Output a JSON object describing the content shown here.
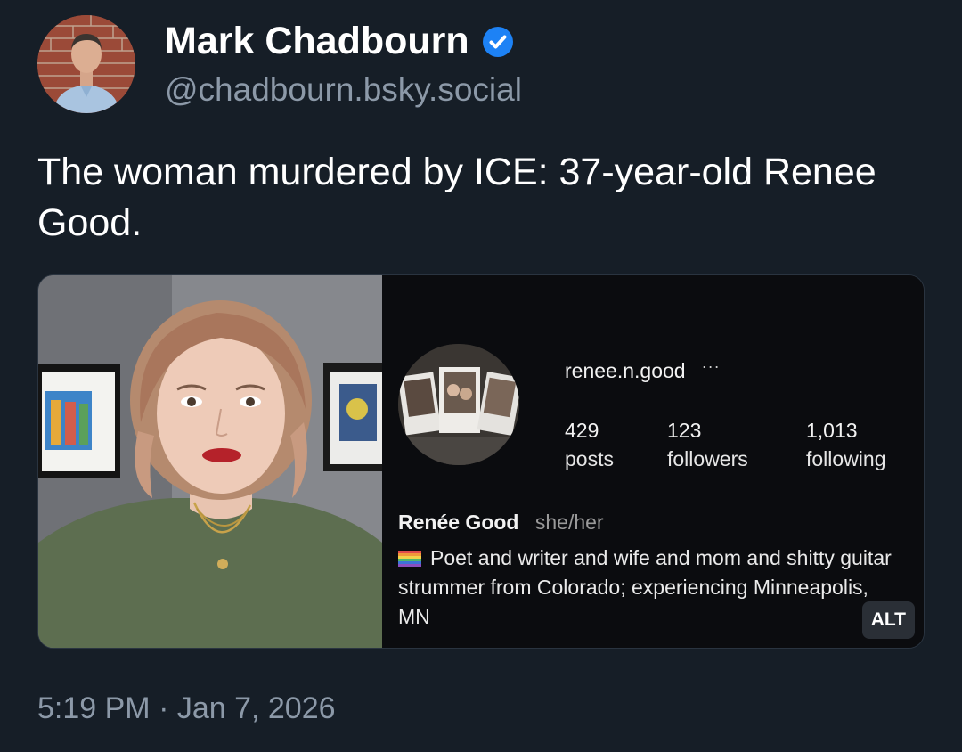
{
  "author": {
    "display_name": "Mark Chadbourn",
    "handle": "@chadbourn.bsky.social",
    "verified": true,
    "avatar_icon": "profile-photo",
    "verified_icon": "verified-badge-icon"
  },
  "post": {
    "text": "The woman murdered by ICE: 37-year-old Renee Good.",
    "timestamp": "5:19 PM · Jan 7, 2026"
  },
  "media": {
    "alt_label": "ALT",
    "instagram_profile": {
      "username": "renee.n.good",
      "more_label": "···",
      "stats": [
        {
          "value": "429",
          "label": "posts"
        },
        {
          "value": "123",
          "label": "followers"
        },
        {
          "value": "1,013",
          "label": "following"
        }
      ],
      "full_name": "Renée Good",
      "pronouns": "she/her",
      "bio": "Poet and writer and wife and mom and shitty guitar strummer from Colorado; experiencing Minneapolis, MN"
    }
  },
  "colors": {
    "background": "#161e27",
    "secondary_text": "#8c99a8",
    "verified_blue": "#1d82f5"
  }
}
